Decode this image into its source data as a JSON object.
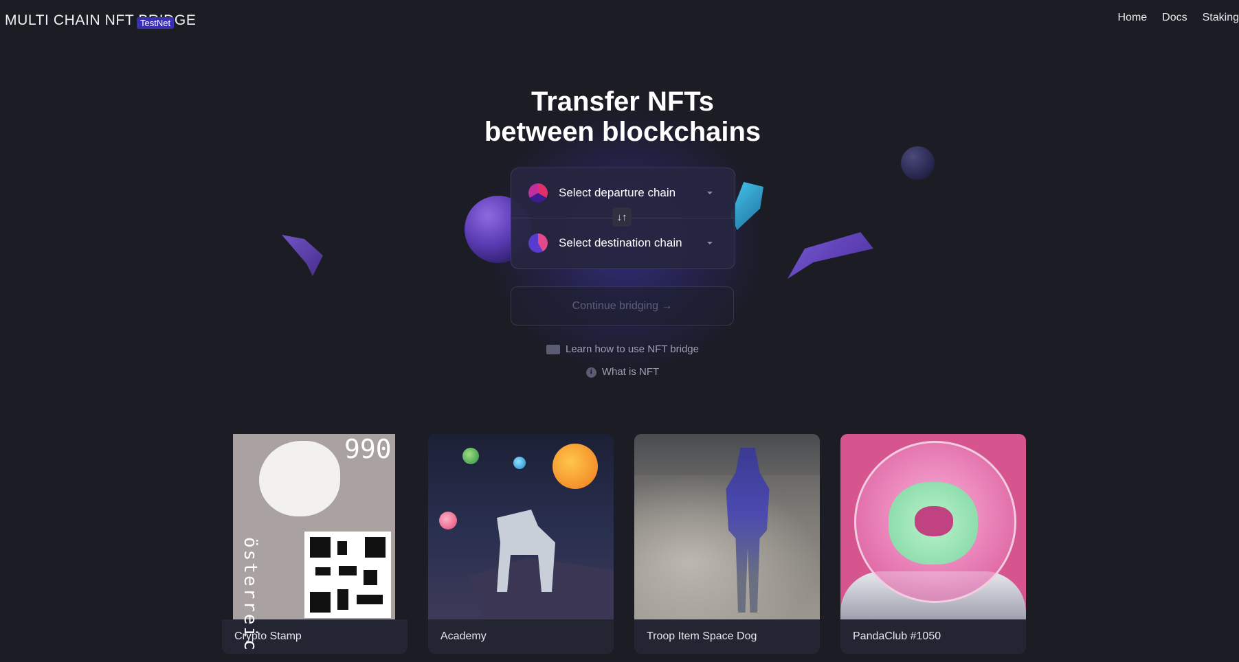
{
  "header": {
    "logo_text": "MULTI CHAIN NFT BRIDGE",
    "badge": "TestNet",
    "nav": [
      {
        "label": "Home"
      },
      {
        "label": "Docs"
      },
      {
        "label": "Staking"
      }
    ]
  },
  "hero": {
    "title_line1": "Transfer NFTs",
    "title_line2": "between blockchains"
  },
  "bridge": {
    "departure_label": "Select departure chain",
    "destination_label": "Select destination chain",
    "swap_glyph": "↓↑",
    "continue_label": "Continue bridging →"
  },
  "help": {
    "learn_label": "Learn how to use NFT bridge",
    "what_label": "What is NFT",
    "info_glyph": "i"
  },
  "nfts": [
    {
      "name": "Crypto Stamp",
      "stamp_value": "990",
      "stamp_country": "österreich"
    },
    {
      "name": "Academy"
    },
    {
      "name": "Troop Item Space Dog"
    },
    {
      "name": "PandaClub #1050"
    }
  ],
  "colors": {
    "background": "#1b1c24",
    "accent": "#3b2fb4",
    "panel": "#262640"
  }
}
